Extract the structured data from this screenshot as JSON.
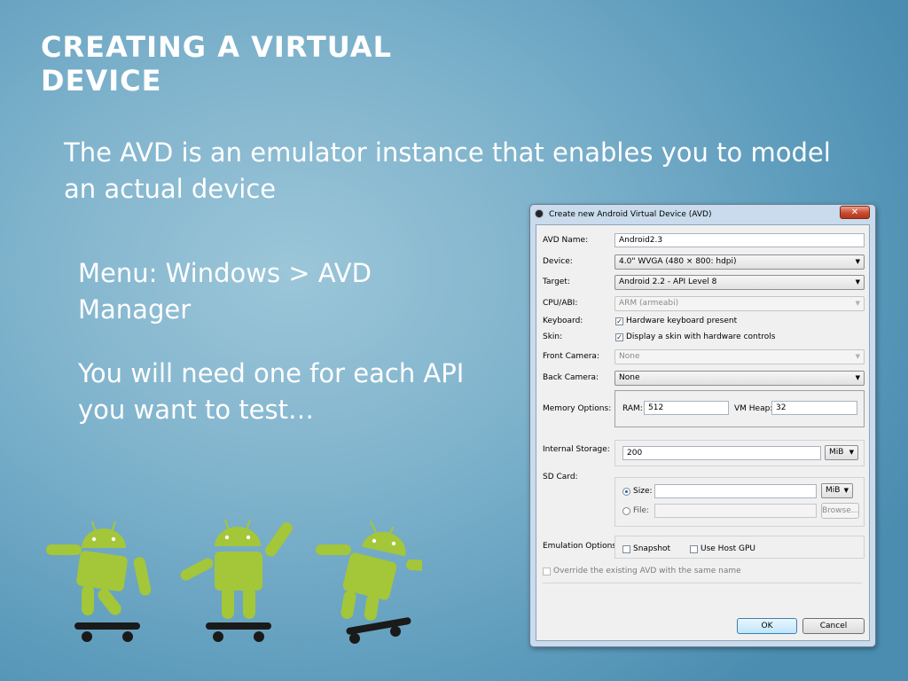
{
  "slide": {
    "title": "CREATING A VIRTUAL DEVICE",
    "intro": "The AVD is an emulator instance that enables you to model an actual device",
    "menu_text": "Menu: Windows > AVD Manager",
    "need_text": "You will need one for each API you want to test…"
  },
  "colors": {
    "android_green": "#a4c639",
    "skateboard": "#1a1a1a",
    "title": "#ffffff"
  },
  "dialog": {
    "title": "Create new Android Virtual Device (AVD)",
    "close_glyph": "✕",
    "labels": {
      "avd_name": "AVD Name:",
      "device": "Device:",
      "target": "Target:",
      "cpu_abi": "CPU/ABI:",
      "keyboard": "Keyboard:",
      "skin": "Skin:",
      "front_camera": "Front Camera:",
      "back_camera": "Back Camera:",
      "memory_options": "Memory Options:",
      "internal_storage": "Internal Storage:",
      "sd_card": "SD Card:",
      "emulation_options": "Emulation Options:"
    },
    "values": {
      "avd_name": "Android2.3",
      "device": "4.0\" WVGA (480 × 800: hdpi)",
      "target": "Android 2.2 - API Level 8",
      "cpu_abi": "ARM (armeabi)",
      "front_camera": "None",
      "back_camera": "None",
      "ram_label": "RAM:",
      "ram": "512",
      "vm_heap_label": "VM Heap:",
      "vm_heap": "32",
      "internal_storage": "200",
      "internal_unit": "MiB",
      "sd_size_label": "Size:",
      "sd_size": "",
      "sd_unit": "MiB",
      "sd_file_label": "File:",
      "sd_file": "",
      "browse": "Browse..."
    },
    "checkboxes": {
      "keyboard": {
        "label": "Hardware keyboard present",
        "checked": true
      },
      "skin": {
        "label": "Display a skin with hardware controls",
        "checked": true
      },
      "snapshot": {
        "label": "Snapshot",
        "checked": false
      },
      "host_gpu": {
        "label": "Use Host GPU",
        "checked": false
      },
      "override": {
        "label": "Override the existing AVD with the same name",
        "checked": false
      }
    },
    "buttons": {
      "ok": "OK",
      "cancel": "Cancel"
    },
    "combo_arrow": "▼"
  }
}
